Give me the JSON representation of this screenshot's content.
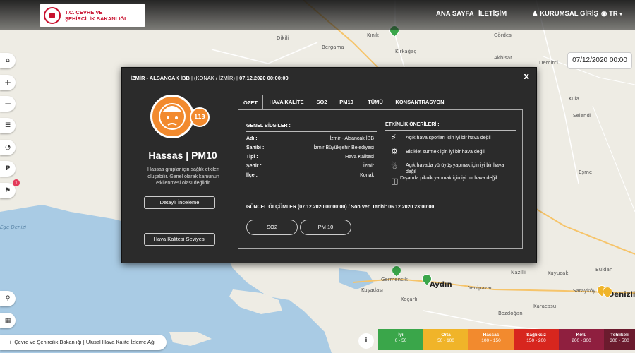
{
  "header": {
    "logo_line1": "T.C. ÇEVRE VE",
    "logo_line2": "ŞEHİRCİLİK BAKANLIĞI",
    "nav_home": "ANA SAYFA",
    "nav_contact": "İLETİŞİM",
    "nav_login": "KURUMSAL GİRİŞ",
    "nav_lang": "TR"
  },
  "sidebar": {
    "notification_count": "1",
    "items": [
      "home-icon",
      "zoom-in-icon",
      "zoom-out-icon",
      "list-icon",
      "chart-icon",
      "filter-icon",
      "megaphone-icon",
      "search-icon",
      "qr-icon"
    ]
  },
  "date_selector": "07/12/2020 00:00",
  "modal": {
    "station": "İZMİR - ALSANCAK İBB",
    "location": "(KONAK / İZMİR)",
    "timestamp": "07.12.2020 00:00:00",
    "close": "X",
    "aqi_value": "113",
    "level_name": "Hassas",
    "pollutant": "PM10",
    "level_desc": "Hassas gruplar için sağlık etkileri oluşabilir. Genel olarak kamunun etkilenmesi olası değildir.",
    "details_button": "Detaylı İnceleme",
    "quality_level_button": "Hava Kalitesi Seviyesi",
    "tabs": [
      "ÖZET",
      "HAVA KALİTE",
      "SO2",
      "PM10",
      "TÜMÜ",
      "KONSANTRASYON"
    ],
    "general_title": "GENEL BİLGİLER :",
    "general": [
      {
        "key": "Adı :",
        "value": "İzmir - Alsancak İBB"
      },
      {
        "key": "Sahibi :",
        "value": "İzmir Büyükşehir Belediyesi"
      },
      {
        "key": "Tipi :",
        "value": "Hava Kalitesi"
      },
      {
        "key": "Şehir :",
        "value": "İzmir"
      },
      {
        "key": "İlçe :",
        "value": "Konak"
      }
    ],
    "activity_title": "ETKİNLİK ÖNERİLERİ :",
    "activities": [
      {
        "icon": "running-icon",
        "text": "Açık hava sporları için iyi bir hava değil"
      },
      {
        "icon": "bicycle-icon",
        "text": "Bisiklet sürmek için iyi bir hava değil"
      },
      {
        "icon": "walking-icon",
        "text": "Açık havada yürüyüş yapmak için iyi bir hava değil"
      },
      {
        "icon": "picnic-basket-icon",
        "text": "Dışarıda piknik yapmak için iyi bir hava değil"
      }
    ],
    "current_title": "GÜNCEL ÖLÇÜMLER (07.12.2020 00:00:00) / Son Veri Tarihi: 06.12.2020 23:00:00",
    "measurements": [
      "SO2",
      "PM 10"
    ]
  },
  "footer": {
    "text": "Çevre ve Şehircilik Bakanlığı | Ulusal Hava Kalite İzleme Ağı"
  },
  "legend": [
    {
      "label": "İyi",
      "range": "0 - 50",
      "color": "#3aa64a"
    },
    {
      "label": "Orta",
      "range": "50 - 100",
      "color": "#f0b429"
    },
    {
      "label": "Hassas",
      "range": "100 - 150",
      "color": "#f28a2e"
    },
    {
      "label": "Sağlıksız",
      "range": "150 - 200",
      "color": "#d7261e"
    },
    {
      "label": "Kötü",
      "range": "200 - 300",
      "color": "#8f1f3f"
    },
    {
      "label": "Tehlikeli",
      "range": "300 - 500",
      "color": "#6b1b2e"
    }
  ],
  "map_labels": [
    "Bergama",
    "Kınık",
    "Dikili",
    "Kırkağaç",
    "Akhisar",
    "Demirci",
    "Gördes",
    "Kula",
    "Selendi",
    "Eşme",
    "Denizli",
    "Aydın",
    "Germencik",
    "Kuşadası",
    "Koçarlı",
    "Bozdoğan",
    "Nazilli",
    "Kuyucak",
    "Yenipazar",
    "Karacasu",
    "Buldan",
    "Sarayköy",
    "Ege Denizi"
  ],
  "colors": {
    "modal_bg": "#2b2b2b",
    "accent_orange": "#f28a2e",
    "marker_green": "#3aa64a"
  }
}
